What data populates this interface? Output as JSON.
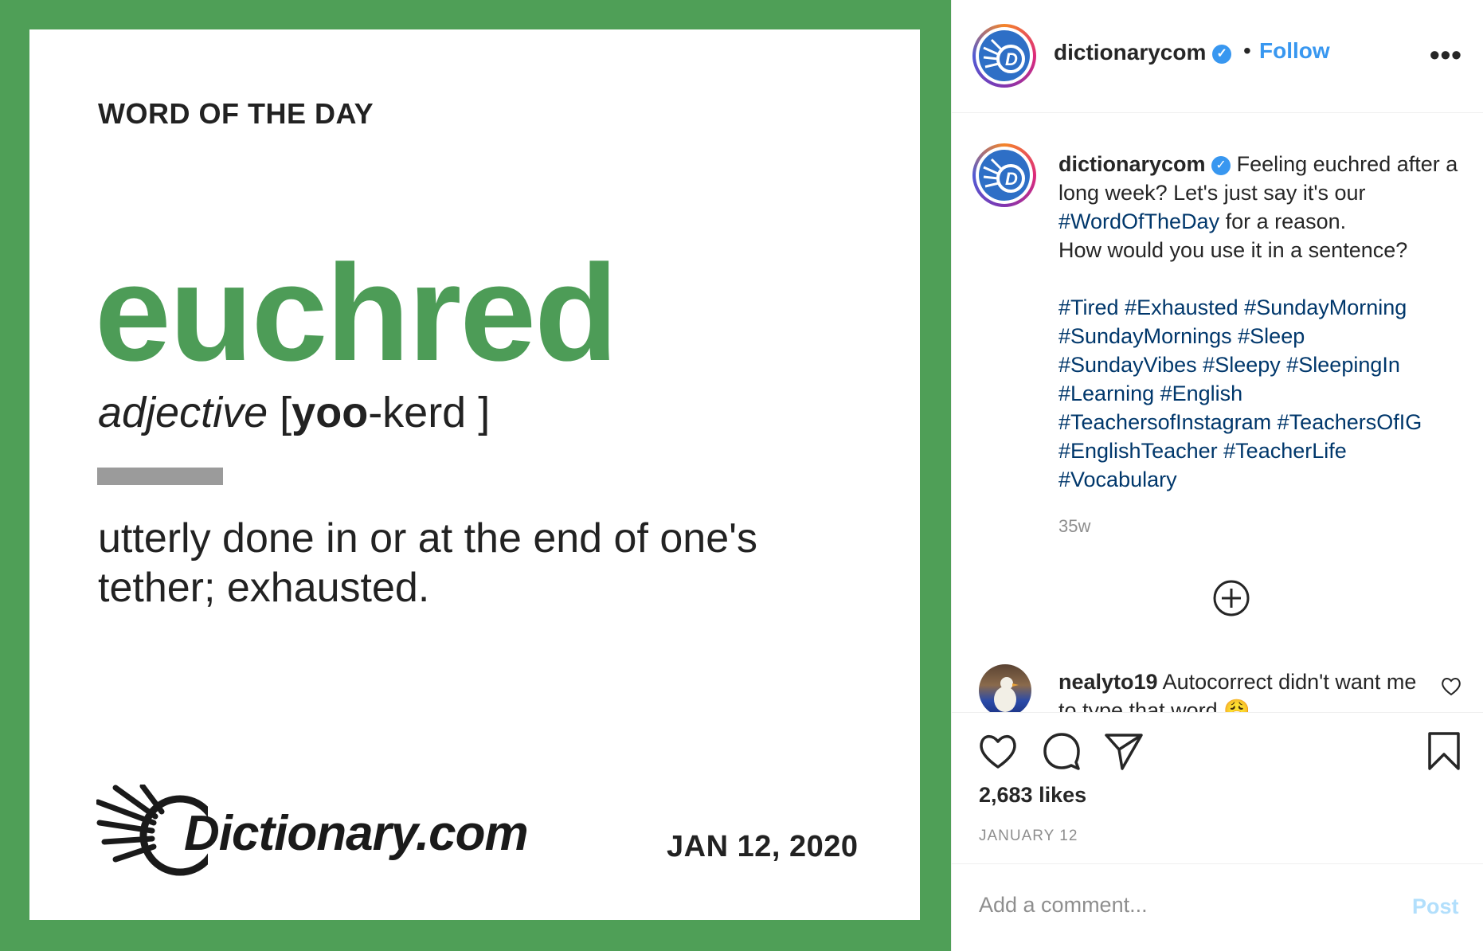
{
  "post_image": {
    "heading": "WORD OF THE DAY",
    "word": "euchred",
    "part_of_speech": "adjective",
    "pron_open": "[",
    "pron_stressed": "yoo",
    "pron_rest": "-kerd",
    "pron_close": "]",
    "definition": "utterly done in or at the end of one's tether; exhausted.",
    "logo_text": "Dictionary.com",
    "date": "JAN 12, 2020",
    "colors": {
      "frame": "#4f9f57",
      "word": "#4d9c57",
      "divider": "#9b9b9b"
    }
  },
  "header": {
    "username": "dictionarycom",
    "verified_icon": "verified-badge-icon",
    "separator": "•",
    "follow_label": "Follow",
    "more_label": "•••"
  },
  "caption": {
    "username": "dictionarycom",
    "text_before": "Feeling euchred after a long week? Let's just say it's our",
    "hashtag": "#WordOfTheDay",
    "text_after": "for a reason.",
    "question": "How would you use it in a sentence?",
    "hashtags": [
      "#Tired",
      "#Exhausted",
      "#SundayMorning",
      "#SundayMornings",
      "#Sleep",
      "#SundayVibes",
      "#Sleepy",
      "#SleepingIn",
      "#Learning",
      "#English",
      "#TeachersofInstagram",
      "#TeachersOfIG",
      "#EnglishTeacher",
      "#TeacherLife",
      "#Vocabulary"
    ],
    "time": "35w"
  },
  "comment": {
    "username": "nealyto19",
    "text": "Autocorrect didn't want me to type that word 😩"
  },
  "actions": {
    "likes": "2,683 likes",
    "date": "JANUARY 12"
  },
  "add_comment": {
    "placeholder": "Add a comment...",
    "post_label": "Post"
  },
  "colors": {
    "link": "#3897f0",
    "hashtag": "#00376b",
    "muted": "#8e8e8e",
    "post_disabled": "#b2dffc"
  }
}
